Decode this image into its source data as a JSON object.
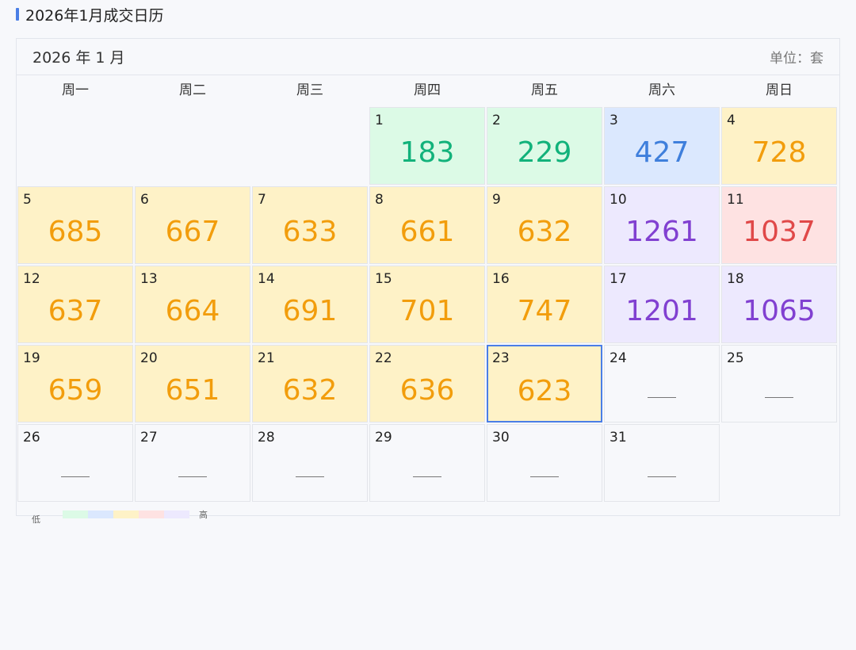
{
  "header": {
    "title": "2026年1月成交日历"
  },
  "calendar": {
    "month_label": "2026 年 1 月",
    "unit_label": "单位：套",
    "weekdays": [
      "周一",
      "周二",
      "周三",
      "周四",
      "周五",
      "周六",
      "周日"
    ],
    "leading_blank_days": 3,
    "today": 23,
    "days": [
      {
        "day": "1",
        "value": "183",
        "level": "green"
      },
      {
        "day": "2",
        "value": "229",
        "level": "green"
      },
      {
        "day": "3",
        "value": "427",
        "level": "blue"
      },
      {
        "day": "4",
        "value": "728",
        "level": "yellow"
      },
      {
        "day": "5",
        "value": "685",
        "level": "yellow"
      },
      {
        "day": "6",
        "value": "667",
        "level": "yellow"
      },
      {
        "day": "7",
        "value": "633",
        "level": "yellow"
      },
      {
        "day": "8",
        "value": "661",
        "level": "yellow"
      },
      {
        "day": "9",
        "value": "632",
        "level": "yellow"
      },
      {
        "day": "10",
        "value": "1261",
        "level": "purple"
      },
      {
        "day": "11",
        "value": "1037",
        "level": "red"
      },
      {
        "day": "12",
        "value": "637",
        "level": "yellow"
      },
      {
        "day": "13",
        "value": "664",
        "level": "yellow"
      },
      {
        "day": "14",
        "value": "691",
        "level": "yellow"
      },
      {
        "day": "15",
        "value": "701",
        "level": "yellow"
      },
      {
        "day": "16",
        "value": "747",
        "level": "yellow"
      },
      {
        "day": "17",
        "value": "1201",
        "level": "purple"
      },
      {
        "day": "18",
        "value": "1065",
        "level": "purple"
      },
      {
        "day": "19",
        "value": "659",
        "level": "yellow"
      },
      {
        "day": "20",
        "value": "651",
        "level": "yellow"
      },
      {
        "day": "21",
        "value": "632",
        "level": "yellow"
      },
      {
        "day": "22",
        "value": "636",
        "level": "yellow"
      },
      {
        "day": "23",
        "value": "623",
        "level": "yellow"
      },
      {
        "day": "24",
        "value": null,
        "level": "none"
      },
      {
        "day": "25",
        "value": null,
        "level": "none"
      },
      {
        "day": "26",
        "value": null,
        "level": "none"
      },
      {
        "day": "27",
        "value": null,
        "level": "none"
      },
      {
        "day": "28",
        "value": null,
        "level": "none"
      },
      {
        "day": "29",
        "value": null,
        "level": "none"
      },
      {
        "day": "30",
        "value": null,
        "level": "none"
      },
      {
        "day": "31",
        "value": null,
        "level": "none"
      }
    ]
  },
  "levels": {
    "green": {
      "bg": "#dcfae6",
      "fg": "#12b27b"
    },
    "blue": {
      "bg": "#dbe8fe",
      "fg": "#3f7fdc"
    },
    "yellow": {
      "bg": "#fef2c7",
      "fg": "#f29d0c"
    },
    "red": {
      "bg": "#fee2e2",
      "fg": "#e04848"
    },
    "purple": {
      "bg": "#ede9fe",
      "fg": "#8140d1"
    },
    "none": {
      "bg": "#f7f8fb",
      "fg": "#777777"
    }
  },
  "legend": {
    "low_label": "低",
    "high_label": "高",
    "scale": [
      "green",
      "blue",
      "yellow",
      "red",
      "purple"
    ]
  },
  "colors": {
    "accent": "#4a7ee6",
    "today_border": "#4a7ee6"
  }
}
